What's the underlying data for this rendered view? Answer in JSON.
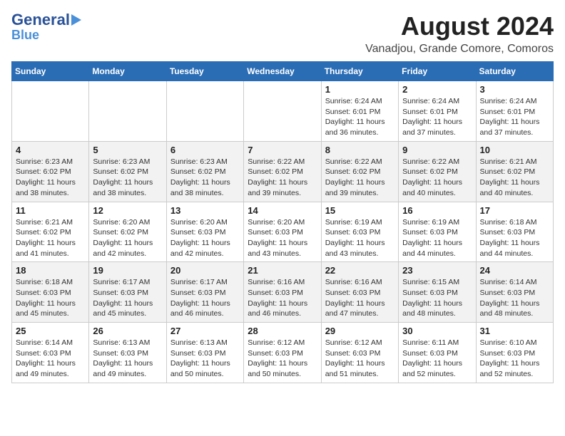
{
  "header": {
    "logo_line1": "General",
    "logo_line2": "Blue",
    "month_title": "August 2024",
    "location": "Vanadjou, Grande Comore, Comoros"
  },
  "days_of_week": [
    "Sunday",
    "Monday",
    "Tuesday",
    "Wednesday",
    "Thursday",
    "Friday",
    "Saturday"
  ],
  "weeks": [
    [
      {
        "day": "",
        "info": ""
      },
      {
        "day": "",
        "info": ""
      },
      {
        "day": "",
        "info": ""
      },
      {
        "day": "",
        "info": ""
      },
      {
        "day": "1",
        "info": "Sunrise: 6:24 AM\nSunset: 6:01 PM\nDaylight: 11 hours\nand 36 minutes."
      },
      {
        "day": "2",
        "info": "Sunrise: 6:24 AM\nSunset: 6:01 PM\nDaylight: 11 hours\nand 37 minutes."
      },
      {
        "day": "3",
        "info": "Sunrise: 6:24 AM\nSunset: 6:01 PM\nDaylight: 11 hours\nand 37 minutes."
      }
    ],
    [
      {
        "day": "4",
        "info": "Sunrise: 6:23 AM\nSunset: 6:02 PM\nDaylight: 11 hours\nand 38 minutes."
      },
      {
        "day": "5",
        "info": "Sunrise: 6:23 AM\nSunset: 6:02 PM\nDaylight: 11 hours\nand 38 minutes."
      },
      {
        "day": "6",
        "info": "Sunrise: 6:23 AM\nSunset: 6:02 PM\nDaylight: 11 hours\nand 38 minutes."
      },
      {
        "day": "7",
        "info": "Sunrise: 6:22 AM\nSunset: 6:02 PM\nDaylight: 11 hours\nand 39 minutes."
      },
      {
        "day": "8",
        "info": "Sunrise: 6:22 AM\nSunset: 6:02 PM\nDaylight: 11 hours\nand 39 minutes."
      },
      {
        "day": "9",
        "info": "Sunrise: 6:22 AM\nSunset: 6:02 PM\nDaylight: 11 hours\nand 40 minutes."
      },
      {
        "day": "10",
        "info": "Sunrise: 6:21 AM\nSunset: 6:02 PM\nDaylight: 11 hours\nand 40 minutes."
      }
    ],
    [
      {
        "day": "11",
        "info": "Sunrise: 6:21 AM\nSunset: 6:02 PM\nDaylight: 11 hours\nand 41 minutes."
      },
      {
        "day": "12",
        "info": "Sunrise: 6:20 AM\nSunset: 6:02 PM\nDaylight: 11 hours\nand 42 minutes."
      },
      {
        "day": "13",
        "info": "Sunrise: 6:20 AM\nSunset: 6:03 PM\nDaylight: 11 hours\nand 42 minutes."
      },
      {
        "day": "14",
        "info": "Sunrise: 6:20 AM\nSunset: 6:03 PM\nDaylight: 11 hours\nand 43 minutes."
      },
      {
        "day": "15",
        "info": "Sunrise: 6:19 AM\nSunset: 6:03 PM\nDaylight: 11 hours\nand 43 minutes."
      },
      {
        "day": "16",
        "info": "Sunrise: 6:19 AM\nSunset: 6:03 PM\nDaylight: 11 hours\nand 44 minutes."
      },
      {
        "day": "17",
        "info": "Sunrise: 6:18 AM\nSunset: 6:03 PM\nDaylight: 11 hours\nand 44 minutes."
      }
    ],
    [
      {
        "day": "18",
        "info": "Sunrise: 6:18 AM\nSunset: 6:03 PM\nDaylight: 11 hours\nand 45 minutes."
      },
      {
        "day": "19",
        "info": "Sunrise: 6:17 AM\nSunset: 6:03 PM\nDaylight: 11 hours\nand 45 minutes."
      },
      {
        "day": "20",
        "info": "Sunrise: 6:17 AM\nSunset: 6:03 PM\nDaylight: 11 hours\nand 46 minutes."
      },
      {
        "day": "21",
        "info": "Sunrise: 6:16 AM\nSunset: 6:03 PM\nDaylight: 11 hours\nand 46 minutes."
      },
      {
        "day": "22",
        "info": "Sunrise: 6:16 AM\nSunset: 6:03 PM\nDaylight: 11 hours\nand 47 minutes."
      },
      {
        "day": "23",
        "info": "Sunrise: 6:15 AM\nSunset: 6:03 PM\nDaylight: 11 hours\nand 48 minutes."
      },
      {
        "day": "24",
        "info": "Sunrise: 6:14 AM\nSunset: 6:03 PM\nDaylight: 11 hours\nand 48 minutes."
      }
    ],
    [
      {
        "day": "25",
        "info": "Sunrise: 6:14 AM\nSunset: 6:03 PM\nDaylight: 11 hours\nand 49 minutes."
      },
      {
        "day": "26",
        "info": "Sunrise: 6:13 AM\nSunset: 6:03 PM\nDaylight: 11 hours\nand 49 minutes."
      },
      {
        "day": "27",
        "info": "Sunrise: 6:13 AM\nSunset: 6:03 PM\nDaylight: 11 hours\nand 50 minutes."
      },
      {
        "day": "28",
        "info": "Sunrise: 6:12 AM\nSunset: 6:03 PM\nDaylight: 11 hours\nand 50 minutes."
      },
      {
        "day": "29",
        "info": "Sunrise: 6:12 AM\nSunset: 6:03 PM\nDaylight: 11 hours\nand 51 minutes."
      },
      {
        "day": "30",
        "info": "Sunrise: 6:11 AM\nSunset: 6:03 PM\nDaylight: 11 hours\nand 52 minutes."
      },
      {
        "day": "31",
        "info": "Sunrise: 6:10 AM\nSunset: 6:03 PM\nDaylight: 11 hours\nand 52 minutes."
      }
    ]
  ]
}
